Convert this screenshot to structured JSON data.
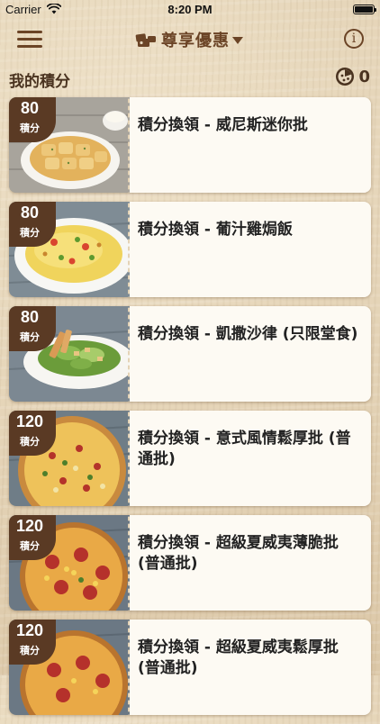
{
  "status_bar": {
    "carrier": "Carrier",
    "time": "8:20 PM"
  },
  "nav": {
    "title": "尊享優惠",
    "info_label": "i",
    "icons": {
      "menu": "menu-icon",
      "wallet": "wallet-icon",
      "caret": "caret-down-icon",
      "info": "info-icon"
    }
  },
  "points": {
    "title": "我的積分",
    "balance": "0",
    "icon": "pizza-icon"
  },
  "rewards": [
    {
      "points": "80",
      "unit": "積分",
      "title": "積分換領 - 威尼斯迷你批",
      "image": "garlic-bread"
    },
    {
      "points": "80",
      "unit": "積分",
      "title": "積分換領 - 葡汁雞焗飯",
      "image": "baked-rice"
    },
    {
      "points": "80",
      "unit": "積分",
      "title": "積分換領 - 凱撒沙律 (只限堂食)",
      "image": "caesar-salad"
    },
    {
      "points": "120",
      "unit": "積分",
      "title": "積分換領 - 意式風情鬆厚批 (普通批)",
      "image": "pizza-pan"
    },
    {
      "points": "120",
      "unit": "積分",
      "title": "積分換領 - 超級夏威夷薄脆批 (普通批)",
      "image": "pizza-thin"
    },
    {
      "points": "120",
      "unit": "積分",
      "title": "積分換領 - 超級夏威夷鬆厚批 (普通批)",
      "image": "pizza-thin"
    }
  ],
  "colors": {
    "brand_brown": "#6b4426",
    "badge": "#5a3a24",
    "card": "#fdfaf3",
    "background": "#e6d7be"
  }
}
